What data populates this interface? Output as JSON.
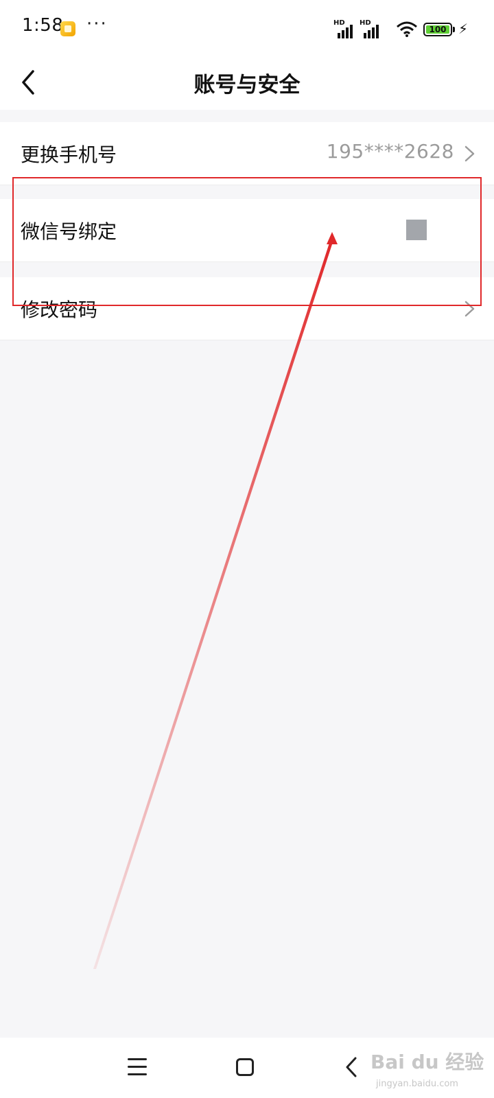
{
  "status_bar": {
    "time": "1:58",
    "signal_1_label": "HD",
    "signal_2_label": "HD",
    "battery_level": "100",
    "icons": [
      "app-notification-icon",
      "more-dots-icon",
      "signal-icon",
      "wifi-icon",
      "battery-icon",
      "charging-icon"
    ]
  },
  "header": {
    "title": "账号与安全",
    "back_icon": "chevron-left-icon"
  },
  "settings": {
    "items": [
      {
        "label": "更换手机号",
        "value": "195****2628",
        "icon": "chevron-right-icon"
      },
      {
        "label": "微信号绑定",
        "value": "",
        "icon": "square-placeholder-icon"
      },
      {
        "label": "修改密码",
        "value": "",
        "icon": "chevron-right-icon"
      }
    ]
  },
  "annotation": {
    "color": "#e0282a"
  },
  "system_nav": {
    "icons": [
      "menu-icon",
      "home-icon",
      "back-icon"
    ]
  },
  "watermark": {
    "text": "Bai du 经验",
    "sub": "jingyan.baidu.com"
  }
}
